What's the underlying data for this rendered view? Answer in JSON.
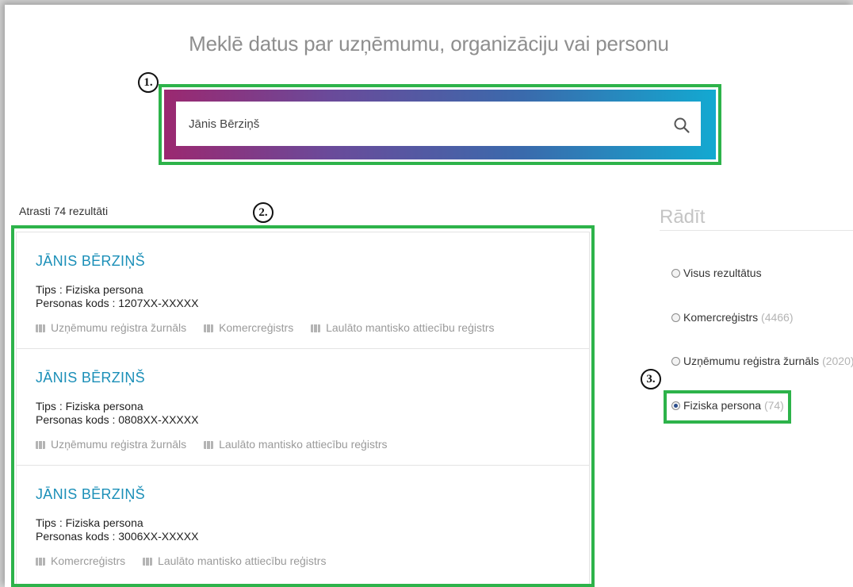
{
  "heading": "Meklē datus par uzņēmumu, organizāciju vai personu",
  "annotations": {
    "m1": "1.",
    "m2": "2.",
    "m3": "3."
  },
  "search": {
    "value": "Jānis Bērziņš"
  },
  "results": {
    "count_text": "Atrasti 74 rezultāti",
    "items": [
      {
        "name": "JĀNIS BĒRZIŅŠ",
        "type": "Tips : Fiziska persona",
        "code": "Personas kods : 1207XX-XXXXX",
        "tags": [
          "Uzņēmumu reģistra žurnāls",
          "Komercreģistrs",
          "Laulāto mantisko attiecību reģistrs"
        ]
      },
      {
        "name": "JĀNIS BĒRZIŅŠ",
        "type": "Tips : Fiziska persona",
        "code": "Personas kods : 0808XX-XXXXX",
        "tags": [
          "Uzņēmumu reģistra žurnāls",
          "Laulāto mantisko attiecību reģistrs"
        ]
      },
      {
        "name": "JĀNIS BĒRZIŅŠ",
        "type": "Tips : Fiziska persona",
        "code": "Personas kods : 3006XX-XXXXX",
        "tags": [
          "Komercreģistrs",
          "Laulāto mantisko attiecību reģistrs"
        ]
      }
    ]
  },
  "filter": {
    "title": "Rādīt",
    "options": [
      {
        "label": "Visus rezultātus",
        "count": "",
        "checked": false
      },
      {
        "label": "Komercreģistrs",
        "count": "(4466)",
        "checked": false
      },
      {
        "label": "Uzņēmumu reģistra žurnāls",
        "count": "(2020)",
        "checked": false
      },
      {
        "label": "Fiziska persona",
        "count": "(74)",
        "checked": true
      }
    ]
  },
  "colors": {
    "highlight": "#2db34a",
    "link": "#1b8fb8",
    "gradient_start": "#9b2870",
    "gradient_end": "#13a9d1"
  },
  "icons": {
    "search": "search-icon",
    "tag": "briefcase-icon"
  }
}
